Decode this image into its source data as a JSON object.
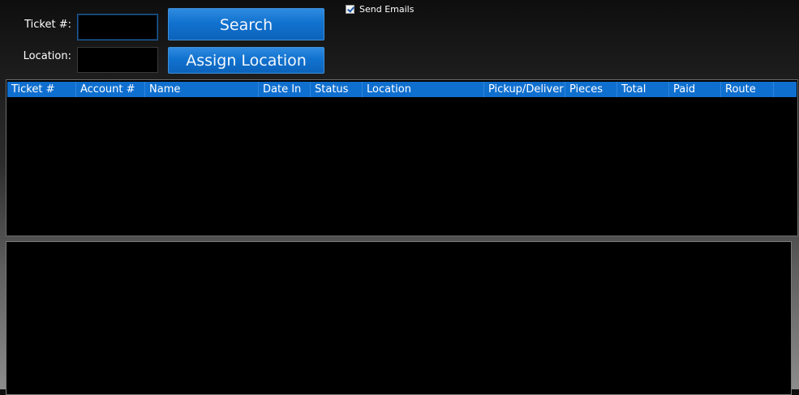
{
  "form": {
    "ticket_label": "Ticket #:",
    "ticket_value": "",
    "location_label": "Location:",
    "location_value": ""
  },
  "buttons": {
    "search_label": "Search",
    "assign_location_label": "Assign Location"
  },
  "options": {
    "send_emails_label": "Send Emails",
    "send_emails_checked": true
  },
  "grid": {
    "columns": [
      "Ticket #",
      "Account #",
      "Name",
      "Date In",
      "Status",
      "Location",
      "Pickup/Deliver",
      "Pieces",
      "Total",
      "Paid",
      "Route"
    ],
    "rows": []
  },
  "colors": {
    "accent": "#0f6fcf",
    "button": "#1172cf",
    "background": "#000000"
  }
}
